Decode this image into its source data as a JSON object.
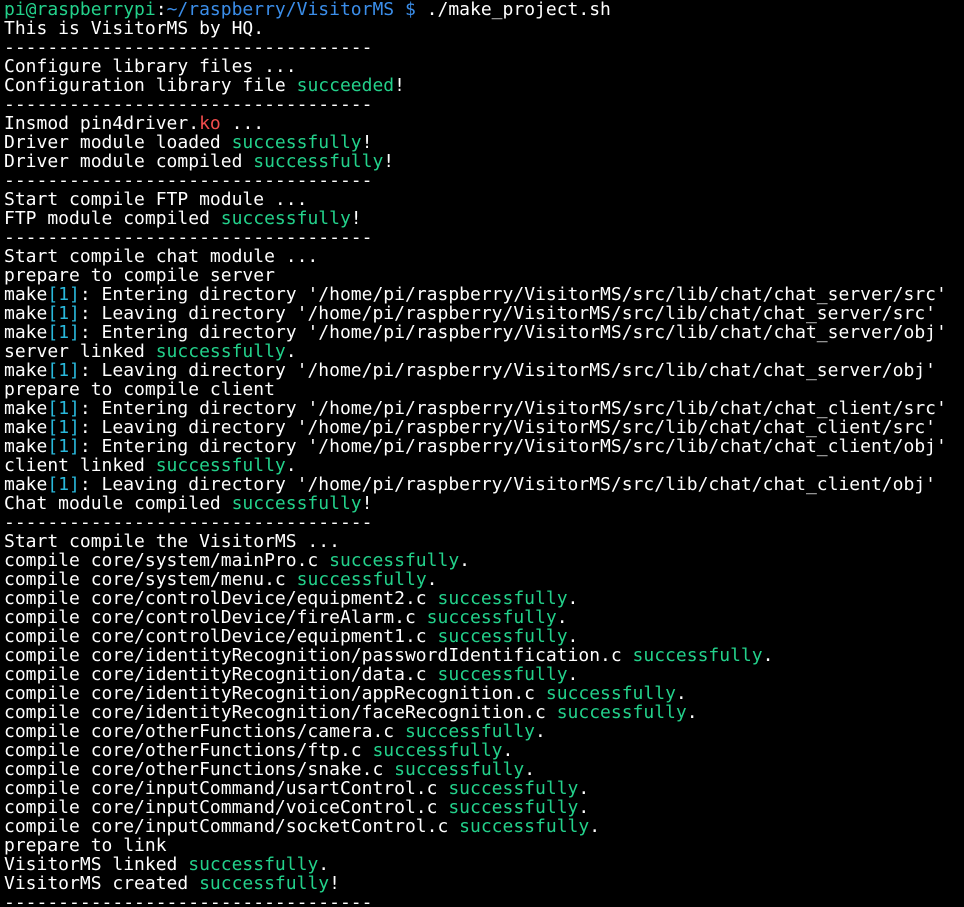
{
  "terminal": {
    "colors": {
      "background": "#000000",
      "text": "#ffffff",
      "success": "#23d18b",
      "module_ext": "#f14c4c",
      "make_level": "#29b8db",
      "prompt_user": "#23d18b",
      "prompt_path": "#3b8eea"
    },
    "lines": [
      [
        {
          "t": "pi@raspberrypi",
          "c": "prompt-user"
        },
        {
          "t": ":",
          "c": "default"
        },
        {
          "t": "~/raspberry/VisitorMS",
          "c": "prompt-path"
        },
        {
          "t": " $ ",
          "c": "prompt-dollar"
        },
        {
          "t": "./make_project.sh",
          "c": "default"
        }
      ],
      [
        {
          "t": "This is VisitorMS by HQ.",
          "c": "default"
        }
      ],
      [
        {
          "t": "----------------------------------",
          "c": "default"
        }
      ],
      [
        {
          "t": "Configure library files ...",
          "c": "default"
        }
      ],
      [
        {
          "t": "Configuration library file ",
          "c": "default"
        },
        {
          "t": "succeeded",
          "c": "green"
        },
        {
          "t": "!",
          "c": "default"
        }
      ],
      [
        {
          "t": "----------------------------------",
          "c": "default"
        }
      ],
      [
        {
          "t": "Insmod pin4driver.",
          "c": "default"
        },
        {
          "t": "ko",
          "c": "red"
        },
        {
          "t": " ...",
          "c": "default"
        }
      ],
      [
        {
          "t": "Driver module loaded ",
          "c": "default"
        },
        {
          "t": "successfully",
          "c": "green"
        },
        {
          "t": "!",
          "c": "default"
        }
      ],
      [
        {
          "t": "Driver module compiled ",
          "c": "default"
        },
        {
          "t": "successfully",
          "c": "green"
        },
        {
          "t": "!",
          "c": "default"
        }
      ],
      [
        {
          "t": "----------------------------------",
          "c": "default"
        }
      ],
      [
        {
          "t": "Start compile FTP module ...",
          "c": "default"
        }
      ],
      [
        {
          "t": "FTP module compiled ",
          "c": "default"
        },
        {
          "t": "successfully",
          "c": "green"
        },
        {
          "t": "!",
          "c": "default"
        }
      ],
      [
        {
          "t": "----------------------------------",
          "c": "default"
        }
      ],
      [
        {
          "t": "Start compile chat module ...",
          "c": "default"
        }
      ],
      [
        {
          "t": "prepare to compile server",
          "c": "default"
        }
      ],
      [
        {
          "t": "make",
          "c": "default"
        },
        {
          "t": "[1]",
          "c": "cyan"
        },
        {
          "t": ": Entering directory '/home/pi/raspberry/VisitorMS/src/lib/chat/chat_server/src'",
          "c": "default"
        }
      ],
      [
        {
          "t": "make",
          "c": "default"
        },
        {
          "t": "[1]",
          "c": "cyan"
        },
        {
          "t": ": Leaving directory '/home/pi/raspberry/VisitorMS/src/lib/chat/chat_server/src'",
          "c": "default"
        }
      ],
      [
        {
          "t": "make",
          "c": "default"
        },
        {
          "t": "[1]",
          "c": "cyan"
        },
        {
          "t": ": Entering directory '/home/pi/raspberry/VisitorMS/src/lib/chat/chat_server/obj'",
          "c": "default"
        }
      ],
      [
        {
          "t": "server linked ",
          "c": "default"
        },
        {
          "t": "successfully",
          "c": "green"
        },
        {
          "t": ".",
          "c": "default"
        }
      ],
      [
        {
          "t": "make",
          "c": "default"
        },
        {
          "t": "[1]",
          "c": "cyan"
        },
        {
          "t": ": Leaving directory '/home/pi/raspberry/VisitorMS/src/lib/chat/chat_server/obj'",
          "c": "default"
        }
      ],
      [
        {
          "t": "prepare to compile client",
          "c": "default"
        }
      ],
      [
        {
          "t": "make",
          "c": "default"
        },
        {
          "t": "[1]",
          "c": "cyan"
        },
        {
          "t": ": Entering directory '/home/pi/raspberry/VisitorMS/src/lib/chat/chat_client/src'",
          "c": "default"
        }
      ],
      [
        {
          "t": "make",
          "c": "default"
        },
        {
          "t": "[1]",
          "c": "cyan"
        },
        {
          "t": ": Leaving directory '/home/pi/raspberry/VisitorMS/src/lib/chat/chat_client/src'",
          "c": "default"
        }
      ],
      [
        {
          "t": "make",
          "c": "default"
        },
        {
          "t": "[1]",
          "c": "cyan"
        },
        {
          "t": ": Entering directory '/home/pi/raspberry/VisitorMS/src/lib/chat/chat_client/obj'",
          "c": "default"
        }
      ],
      [
        {
          "t": "client linked ",
          "c": "default"
        },
        {
          "t": "successfully",
          "c": "green"
        },
        {
          "t": ".",
          "c": "default"
        }
      ],
      [
        {
          "t": "make",
          "c": "default"
        },
        {
          "t": "[1]",
          "c": "cyan"
        },
        {
          "t": ": Leaving directory '/home/pi/raspberry/VisitorMS/src/lib/chat/chat_client/obj'",
          "c": "default"
        }
      ],
      [
        {
          "t": "Chat module compiled ",
          "c": "default"
        },
        {
          "t": "successfully",
          "c": "green"
        },
        {
          "t": "!",
          "c": "default"
        }
      ],
      [
        {
          "t": "----------------------------------",
          "c": "default"
        }
      ],
      [
        {
          "t": "Start compile the VisitorMS ...",
          "c": "default"
        }
      ],
      [
        {
          "t": "compile core/system/mainPro.c ",
          "c": "default"
        },
        {
          "t": "successfully",
          "c": "green"
        },
        {
          "t": ".",
          "c": "default"
        }
      ],
      [
        {
          "t": "compile core/system/menu.c ",
          "c": "default"
        },
        {
          "t": "successfully",
          "c": "green"
        },
        {
          "t": ".",
          "c": "default"
        }
      ],
      [
        {
          "t": "compile core/controlDevice/equipment2.c ",
          "c": "default"
        },
        {
          "t": "successfully",
          "c": "green"
        },
        {
          "t": ".",
          "c": "default"
        }
      ],
      [
        {
          "t": "compile core/controlDevice/fireAlarm.c ",
          "c": "default"
        },
        {
          "t": "successfully",
          "c": "green"
        },
        {
          "t": ".",
          "c": "default"
        }
      ],
      [
        {
          "t": "compile core/controlDevice/equipment1.c ",
          "c": "default"
        },
        {
          "t": "successfully",
          "c": "green"
        },
        {
          "t": ".",
          "c": "default"
        }
      ],
      [
        {
          "t": "compile core/identityRecognition/passwordIdentification.c ",
          "c": "default"
        },
        {
          "t": "successfully",
          "c": "green"
        },
        {
          "t": ".",
          "c": "default"
        }
      ],
      [
        {
          "t": "compile core/identityRecognition/data.c ",
          "c": "default"
        },
        {
          "t": "successfully",
          "c": "green"
        },
        {
          "t": ".",
          "c": "default"
        }
      ],
      [
        {
          "t": "compile core/identityRecognition/appRecognition.c ",
          "c": "default"
        },
        {
          "t": "successfully",
          "c": "green"
        },
        {
          "t": ".",
          "c": "default"
        }
      ],
      [
        {
          "t": "compile core/identityRecognition/faceRecognition.c ",
          "c": "default"
        },
        {
          "t": "successfully",
          "c": "green"
        },
        {
          "t": ".",
          "c": "default"
        }
      ],
      [
        {
          "t": "compile core/otherFunctions/camera.c ",
          "c": "default"
        },
        {
          "t": "successfully",
          "c": "green"
        },
        {
          "t": ".",
          "c": "default"
        }
      ],
      [
        {
          "t": "compile core/otherFunctions/ftp.c ",
          "c": "default"
        },
        {
          "t": "successfully",
          "c": "green"
        },
        {
          "t": ".",
          "c": "default"
        }
      ],
      [
        {
          "t": "compile core/otherFunctions/snake.c ",
          "c": "default"
        },
        {
          "t": "successfully",
          "c": "green"
        },
        {
          "t": ".",
          "c": "default"
        }
      ],
      [
        {
          "t": "compile core/inputCommand/usartControl.c ",
          "c": "default"
        },
        {
          "t": "successfully",
          "c": "green"
        },
        {
          "t": ".",
          "c": "default"
        }
      ],
      [
        {
          "t": "compile core/inputCommand/voiceControl.c ",
          "c": "default"
        },
        {
          "t": "successfully",
          "c": "green"
        },
        {
          "t": ".",
          "c": "default"
        }
      ],
      [
        {
          "t": "compile core/inputCommand/socketControl.c ",
          "c": "default"
        },
        {
          "t": "successfully",
          "c": "green"
        },
        {
          "t": ".",
          "c": "default"
        }
      ],
      [
        {
          "t": "prepare to link",
          "c": "default"
        }
      ],
      [
        {
          "t": "VisitorMS linked ",
          "c": "default"
        },
        {
          "t": "successfully",
          "c": "green"
        },
        {
          "t": ".",
          "c": "default"
        }
      ],
      [
        {
          "t": "VisitorMS created ",
          "c": "default"
        },
        {
          "t": "successfully",
          "c": "green"
        },
        {
          "t": "!",
          "c": "default"
        }
      ],
      [
        {
          "t": "----------------------------------",
          "c": "default"
        }
      ]
    ]
  }
}
